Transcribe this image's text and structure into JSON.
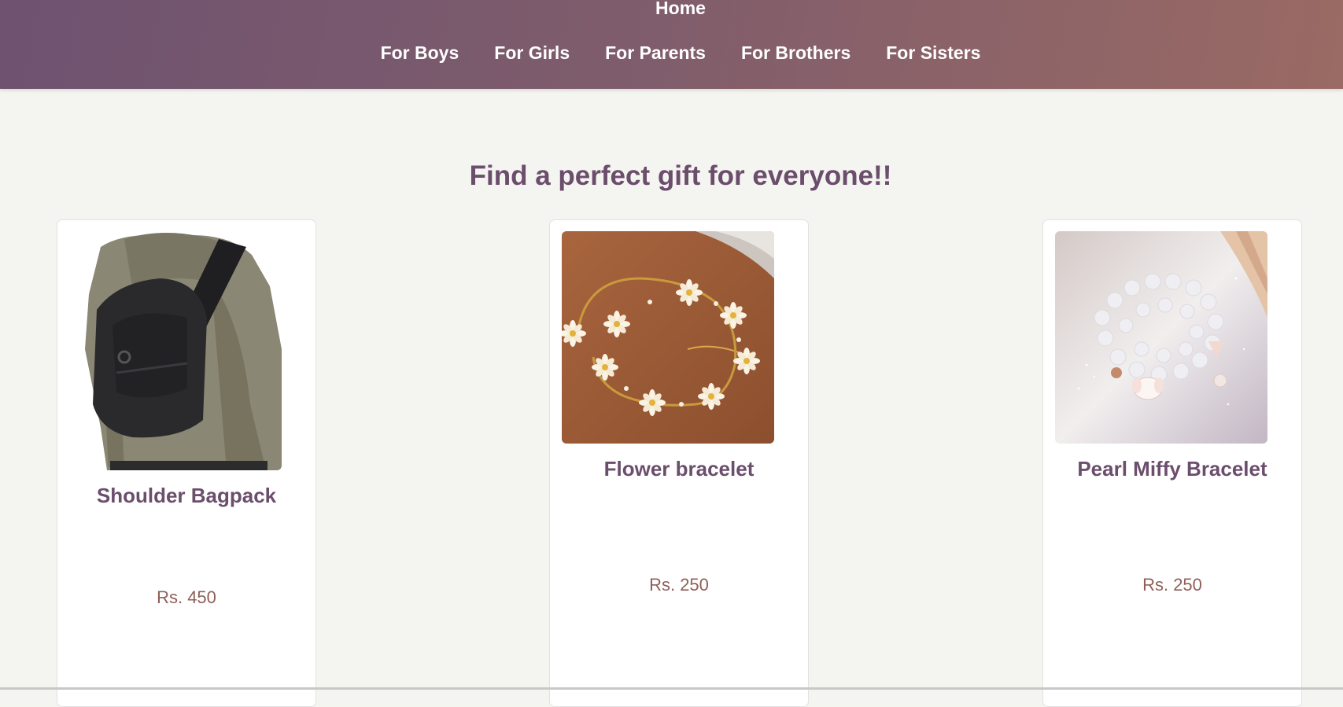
{
  "header": {
    "home_label": "Home",
    "nav": [
      "For Boys",
      "For Girls",
      "For Parents",
      "For Brothers",
      "For Sisters"
    ]
  },
  "main": {
    "headline": "Find a perfect gift for everyone!!",
    "products": [
      {
        "name": "Shoulder Bagpack",
        "price": "Rs. 450",
        "image_icon": "backpack-photo"
      },
      {
        "name": "Flower bracelet",
        "price": "Rs. 250",
        "image_icon": "daisy-bracelet-photo"
      },
      {
        "name": "Pearl Miffy Bracelet",
        "price": "Rs. 250",
        "image_icon": "pearl-bracelet-photo"
      }
    ]
  },
  "colors": {
    "header_start": "#6e5270",
    "header_end": "#9a6a64",
    "title": "#6b4d6c",
    "price": "#8f5f58",
    "background": "#f4f4f0"
  }
}
